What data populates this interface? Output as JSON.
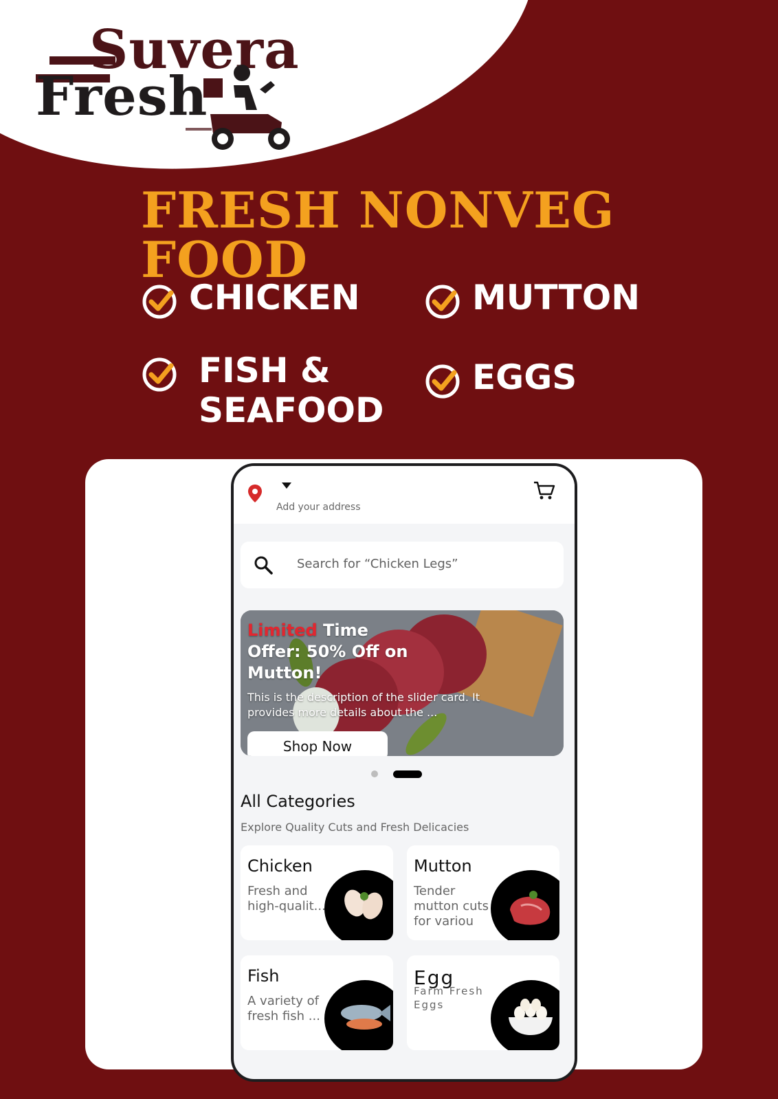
{
  "brand": {
    "line_1": "Suvera",
    "line_2": "Fresh",
    "colors": {
      "maroon": "#6f0f11",
      "brand": "#4b1317",
      "accent": "#f4a11f"
    }
  },
  "headline": "FRESH NONVEG FOOD",
  "features": [
    "CHICKEN",
    "MUTTON",
    "FISH &",
    "SEAFOOD",
    "EGGS"
  ],
  "app": {
    "address_placeholder": "Add your address",
    "search_placeholder": "Search for “Chicken Legs”",
    "banner": {
      "title_accent": "Limited",
      "title_rest": " Time Offer: 50% Off on Mutton!",
      "description": "This is the description of the slider card. It provides more details about the ...",
      "button": "Shop Now"
    },
    "categories_title": "All Categories",
    "categories_subtitle": "Explore Quality Cuts and Fresh Delicacies",
    "categories": [
      {
        "name": "Chicken",
        "description": "Fresh and high-qualit..."
      },
      {
        "name": "Mutton",
        "description": "Tender mutton cuts for variou"
      },
      {
        "name": "Fish",
        "description": "A variety of fresh fish ..."
      },
      {
        "name": "Egg",
        "description": "Farm Fresh Eggs"
      }
    ]
  }
}
